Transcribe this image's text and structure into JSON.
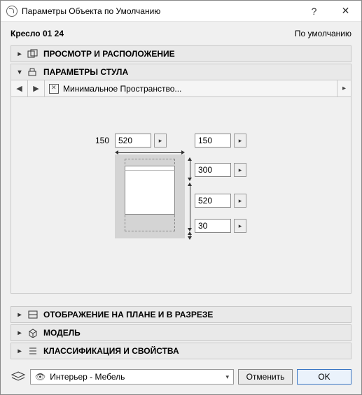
{
  "window": {
    "title": "Параметры Объекта по Умолчанию",
    "help_glyph": "?",
    "close_glyph": "✕"
  },
  "header": {
    "object_name": "Кресло 01 24",
    "default_label": "По умолчанию"
  },
  "panels": {
    "preview": {
      "label": "ПРОСМОТР И РАСПОЛОЖЕНИЕ",
      "arrow": "▸"
    },
    "chair": {
      "label": "ПАРАМЕТРЫ СТУЛА",
      "arrow": "▾"
    },
    "nav": {
      "back": "◀",
      "fwd": "▶",
      "end": "▸",
      "label": "Минимальное Пространство..."
    },
    "display": {
      "label": "ОТОБРАЖЕНИЕ НА ПЛАНЕ И В РАЗРЕЗЕ",
      "arrow": "▸"
    },
    "model": {
      "label": "МОДЕЛЬ",
      "arrow": "▸"
    },
    "classify": {
      "label": "КЛАССИФИКАЦИЯ И СВОЙСТВА",
      "arrow": "▸"
    }
  },
  "params": {
    "fixed_label": "150",
    "width": "520",
    "depth": "150",
    "gap_top": "300",
    "seat": "520",
    "gap_bottom": "30",
    "stepper_glyph": "▸"
  },
  "footer": {
    "layer": "Интерьер - Мебель",
    "eye_glyph": "👁",
    "dd_glyph": "▾",
    "cancel": "Отменить",
    "ok": "OK"
  }
}
